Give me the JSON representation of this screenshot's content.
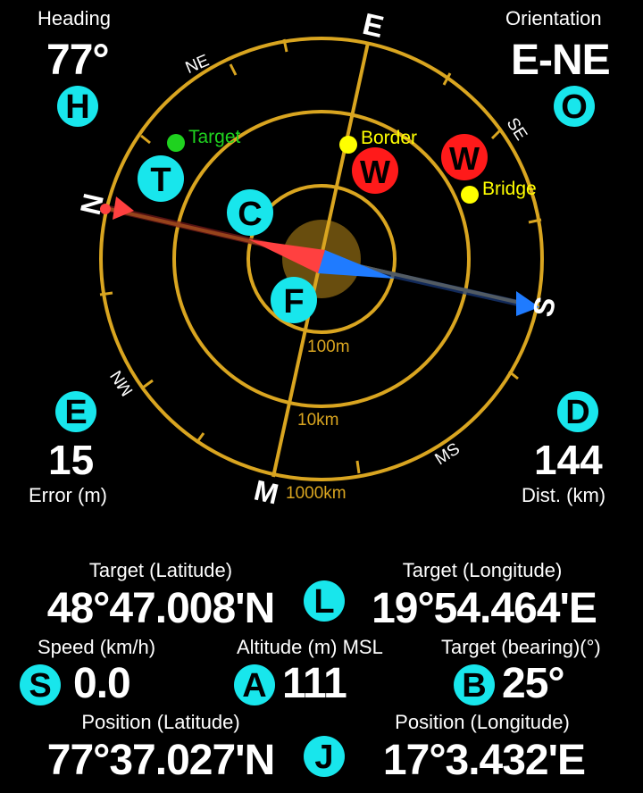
{
  "colors": {
    "background": "#000000",
    "ring": "#d9a520",
    "badge": "#18e6ec",
    "warning": "#ff1a1a",
    "target": "#1fd21f",
    "poi": "#ffff00",
    "arrow_north": "#ff4040",
    "arrow_south": "#1f7bff"
  },
  "heading": {
    "label": "Heading",
    "value": "77°",
    "badge": "H"
  },
  "orientation": {
    "label": "Orientation",
    "value": "E-NE",
    "badge": "O"
  },
  "error": {
    "badge": "E",
    "value": "15",
    "label": "Error (m)"
  },
  "distance": {
    "badge": "D",
    "value": "144",
    "label": "Dist. (km)"
  },
  "compass": {
    "directions": {
      "e": "E",
      "n": "N",
      "s": "S",
      "m": "M",
      "ne": "NE",
      "se": "SE",
      "mn": "MN",
      "ms": "MS"
    },
    "ring_labels": {
      "inner": "100m",
      "middle": "10km",
      "outer": "1000km"
    },
    "markers": {
      "target": "Target",
      "border": "Border",
      "bridge": "Bridge"
    },
    "badges": {
      "target": "T",
      "center": "C",
      "focus": "F",
      "warning1": "W",
      "warning2": "W"
    }
  },
  "target_lat": {
    "label": "Target (Latitude)",
    "value": "48°47.008'N"
  },
  "target_lon": {
    "label": "Target (Longitude)",
    "value": "19°54.464'E",
    "badge": "L"
  },
  "speed": {
    "label": "Speed (km/h)",
    "value": "0.0",
    "badge": "S"
  },
  "altitude": {
    "label": "Altitude (m) MSL",
    "value": "111",
    "badge": "A"
  },
  "bearing": {
    "label": "Target (bearing)(°)",
    "value": "25°",
    "badge": "B"
  },
  "pos_lat": {
    "label": "Position (Latitude)",
    "value": "77°37.027'N"
  },
  "pos_lon": {
    "label": "Position (Longitude)",
    "value": "17°3.432'E",
    "badge": "J"
  }
}
